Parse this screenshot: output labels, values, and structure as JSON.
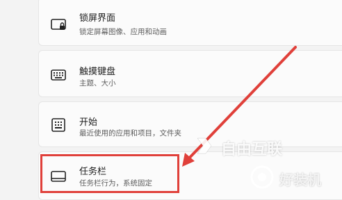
{
  "items": [
    {
      "title": "锁屏界面",
      "subtitle": "锁定屏幕图像、应用和动画",
      "icon": "lock-screen-icon"
    },
    {
      "title": "触摸键盘",
      "subtitle": "主题、大小",
      "icon": "keyboard-icon"
    },
    {
      "title": "开始",
      "subtitle": "最近使用的应用和项目，文件夹",
      "icon": "start-menu-icon"
    },
    {
      "title": "任务栏",
      "subtitle": "任务栏行为，系统固定",
      "icon": "taskbar-icon"
    }
  ],
  "annotation": {
    "color": "#e0403a"
  },
  "watermarks": [
    "自由互联",
    "好装机"
  ]
}
